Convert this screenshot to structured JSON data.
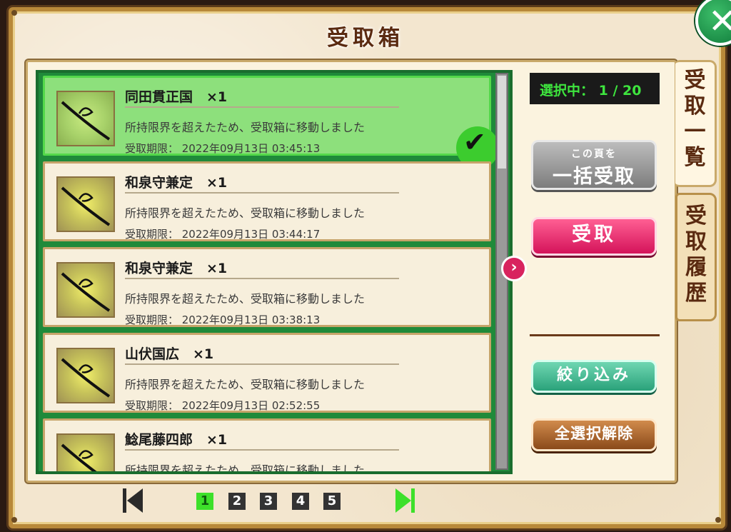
{
  "header": {
    "title": "受取箱"
  },
  "selection": {
    "count_text": "選択中： 1 / 20"
  },
  "items": [
    {
      "name": "同田貫正国　×1",
      "description": "所持限界を超えたため、受取箱に移動しました",
      "deadline": "受取期限： 2022年09月13日 03:45:13",
      "selected": true
    },
    {
      "name": "和泉守兼定　×1",
      "description": "所持限界を超えたため、受取箱に移動しました",
      "deadline": "受取期限： 2022年09月13日 03:44:17",
      "selected": false
    },
    {
      "name": "和泉守兼定　×1",
      "description": "所持限界を超えたため、受取箱に移動しました",
      "deadline": "受取期限： 2022年09月13日 03:38:13",
      "selected": false
    },
    {
      "name": "山伏国広　×1",
      "description": "所持限界を超えたため、受取箱に移動しました",
      "deadline": "受取期限： 2022年09月13日 02:52:55",
      "selected": false
    },
    {
      "name": "鯰尾藤四郎　×1",
      "description": "所持限界を超えたため、受取箱に移動しました",
      "deadline": "",
      "selected": false
    }
  ],
  "buttons": {
    "bulk_small": "この頁を",
    "bulk_big": "一括受取",
    "receive": "受取",
    "filter": "絞り込み",
    "deselect_all": "全選択解除"
  },
  "tabs": {
    "list": "受取一覧",
    "history": "受取履歴"
  },
  "pagination": {
    "pages": [
      "1",
      "2",
      "3",
      "4",
      "5"
    ],
    "current": "1"
  },
  "icons": {
    "close": "close-icon",
    "next": "chevron-right-icon",
    "check": "checkmark-icon",
    "first": "first-page-icon",
    "last": "last-page-icon"
  },
  "colors": {
    "accent_green": "#3de02a",
    "receive_pink": "#d4135a"
  }
}
